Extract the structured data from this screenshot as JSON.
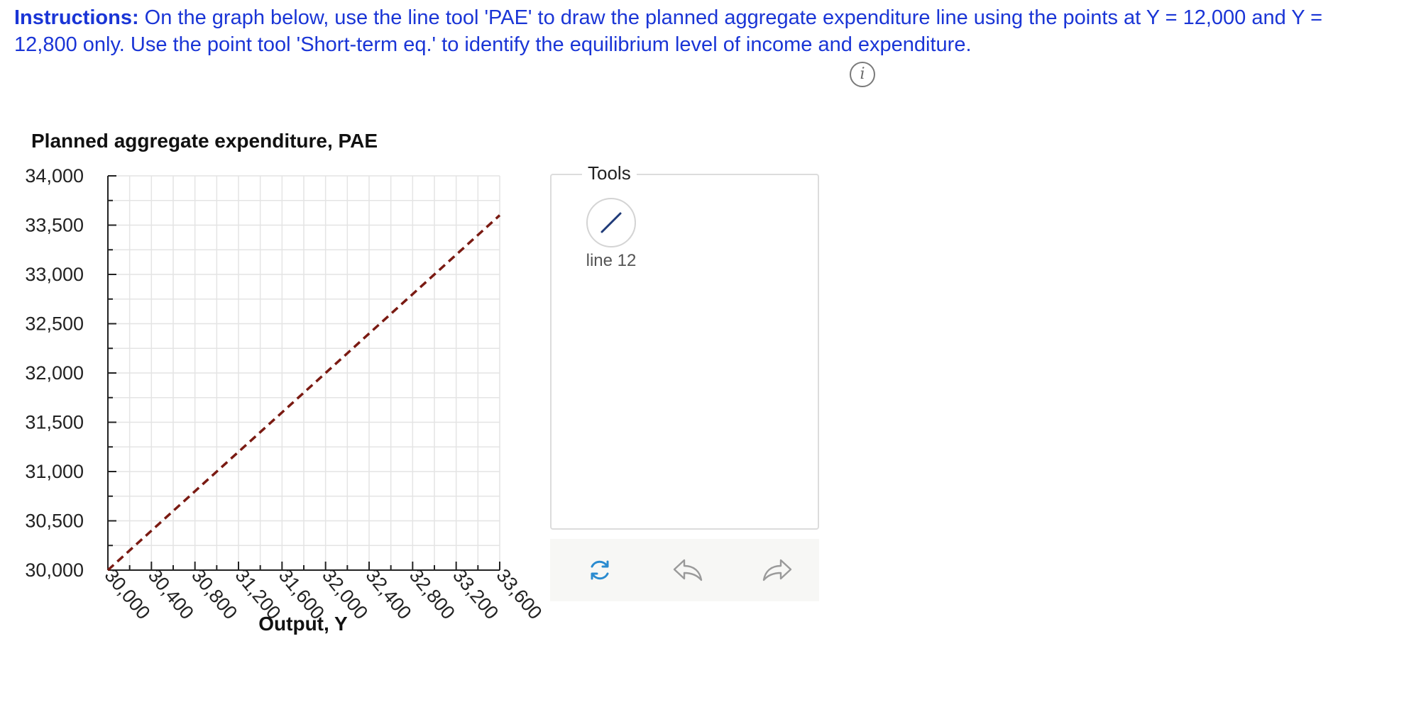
{
  "instructions": {
    "lead": "Instructions:",
    "text": " On the graph below, use the line tool  'PAE' to draw the planned aggregate expenditure line using the points at Y = 12,000 and Y = 12,800 only. Use the point tool 'Short-term eq.' to identify the equilibrium level of income and expenditure."
  },
  "info_icon": "info-icon",
  "tools": {
    "title": "Tools",
    "line_tool_icon": "line-tool-icon",
    "line_tool_label": "line 12"
  },
  "actions": {
    "reset_icon": "reset-icon",
    "undo_icon": "undo-icon",
    "redo_icon": "redo-icon"
  },
  "colors": {
    "instruction_text": "#1a35d6",
    "dashed_line": "#7a1a12",
    "grid": "#e4e4e4",
    "tool_icon": "#1f3a78",
    "reset_icon": "#2a8bd0"
  },
  "chart_data": {
    "type": "line",
    "ylabel": "Planned aggregate expenditure, PAE",
    "xlabel": "Output, Y",
    "xlim": [
      30000,
      33600
    ],
    "ylim": [
      30000,
      34000
    ],
    "x_ticks": [
      "30,000",
      "30,400",
      "30,800",
      "31,200",
      "31,600",
      "32,000",
      "32,400",
      "32,800",
      "33,200",
      "33,600"
    ],
    "x_tick_values": [
      30000,
      30400,
      30800,
      31200,
      31600,
      32000,
      32400,
      32800,
      33200,
      33600
    ],
    "y_ticks": [
      "34,000",
      "33,500",
      "33,000",
      "32,500",
      "32,000",
      "31,500",
      "31,000",
      "30,500",
      "30,000"
    ],
    "y_tick_values": [
      34000,
      33500,
      33000,
      32500,
      32000,
      31500,
      31000,
      30500,
      30000
    ],
    "grid": true,
    "x_minor_step": 200,
    "y_minor_step": 250,
    "series": [
      {
        "style": "dashed",
        "x": [
          30000,
          33600
        ],
        "y": [
          30000,
          33600
        ]
      }
    ]
  }
}
